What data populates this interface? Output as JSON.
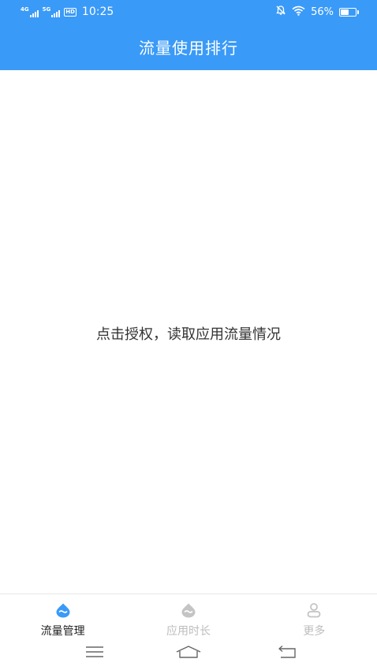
{
  "status_bar": {
    "network1": "4G",
    "network2": "5G",
    "hd_badge": "HD",
    "time": "10:25",
    "battery_percent": "56%",
    "battery_level": 0.56
  },
  "header": {
    "title": "流量使用排行"
  },
  "main": {
    "prompt_text": "点击授权，读取应用流量情况"
  },
  "tabs": [
    {
      "label": "流量管理",
      "icon": "drop-wave-icon",
      "active": true
    },
    {
      "label": "应用时长",
      "icon": "drop-wave-icon",
      "active": false
    },
    {
      "label": "更多",
      "icon": "user-icon",
      "active": false
    }
  ],
  "colors": {
    "header_bg": "#3a9af7",
    "tab_active_icon": "#3a9af7",
    "tab_inactive": "#bdbdbd"
  },
  "nav_bar": {
    "buttons": [
      "menu-icon",
      "home-icon",
      "back-icon"
    ]
  }
}
